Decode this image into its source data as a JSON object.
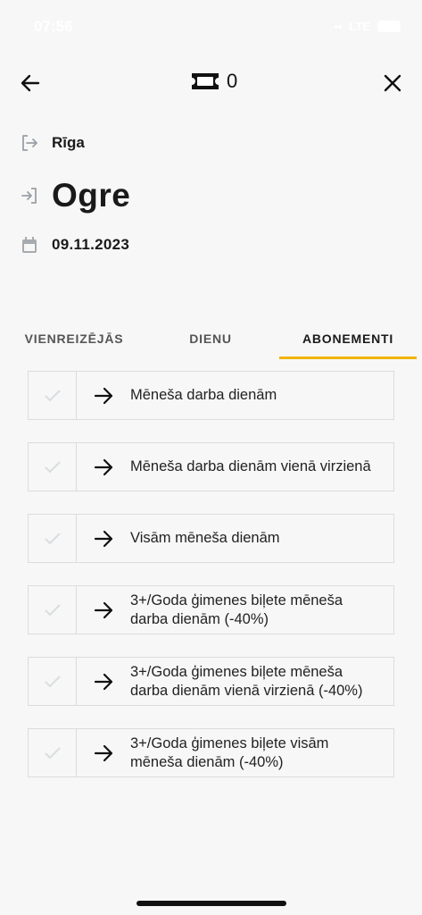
{
  "status": {
    "time": "07:56",
    "network": "LTE",
    "battery": "70"
  },
  "header": {
    "back_icon": "arrow-left-icon",
    "ticket_icon": "ticket-icon",
    "ticket_count": "0",
    "close_icon": "close-icon"
  },
  "route": {
    "from_icon": "exit-icon",
    "from": "Rīga",
    "to_icon": "enter-icon",
    "to": "Ogre",
    "date_icon": "calendar-icon",
    "date": "09.11.2023"
  },
  "tabs": [
    {
      "label": "VIENREIZĒJĀS",
      "active": false
    },
    {
      "label": "DIENU",
      "active": false
    },
    {
      "label": "ABONEMENTI",
      "active": true
    }
  ],
  "accent_color": "#f0b400",
  "options": [
    {
      "label": "Mēneša darba dienām"
    },
    {
      "label": "Mēneša darba dienām vienā virzienā"
    },
    {
      "label": "Visām mēneša dienām"
    },
    {
      "label": "3+/Goda ģimenes biļete mēneša\ndarba dienām (-40%)"
    },
    {
      "label": "3+/Goda ģimenes biļete mēneša\ndarba dienām vienā virzienā (-40%)"
    },
    {
      "label": "3+/Goda ģimenes biļete visām\nmēneša dienām (-40%)"
    }
  ]
}
